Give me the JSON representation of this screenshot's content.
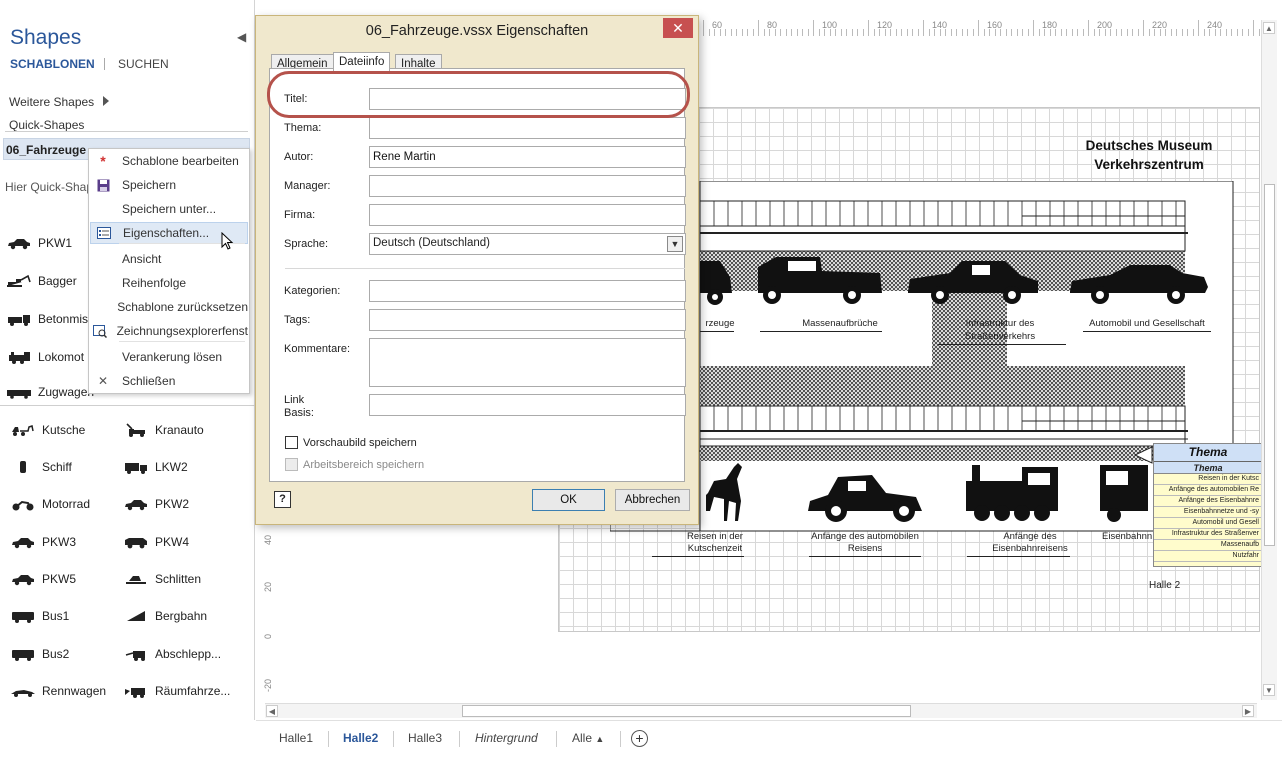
{
  "shapes_pane": {
    "title": "Shapes",
    "tab_schablonen": "SCHABLONEN",
    "tab_suchen": "SUCHEN",
    "weitere_shapes": "Weitere Shapes",
    "quick_shapes": "Quick-Shapes",
    "stencil_name": "06_Fahrzeuge",
    "quick_hint": "Hier Quick-Shap",
    "quick_items": [
      {
        "label": "PKW1",
        "icon": "car-icon"
      },
      {
        "label": "Bagger",
        "icon": "excavator-icon"
      },
      {
        "label": "Betonmis",
        "icon": "concrete-mixer-icon"
      },
      {
        "label": "Lokomot",
        "icon": "locomotive-icon"
      },
      {
        "label": "Zugwagen",
        "icon": "train-wagon-icon"
      }
    ],
    "stencil_items": [
      {
        "label": "Kutsche",
        "icon": "carriage-icon"
      },
      {
        "label": "Kranauto",
        "icon": "crane-truck-icon"
      },
      {
        "label": "Schiff",
        "icon": "ship-icon"
      },
      {
        "label": "LKW2",
        "icon": "truck-icon"
      },
      {
        "label": "Motorrad",
        "icon": "motorcycle-icon"
      },
      {
        "label": "PKW2",
        "icon": "car-icon"
      },
      {
        "label": "PKW3",
        "icon": "car-icon"
      },
      {
        "label": "PKW4",
        "icon": "suv-icon"
      },
      {
        "label": "PKW5",
        "icon": "car-icon"
      },
      {
        "label": "Schlitten",
        "icon": "sled-icon"
      },
      {
        "label": "Bus1",
        "icon": "bus-icon"
      },
      {
        "label": "Bergbahn",
        "icon": "cable-car-icon"
      },
      {
        "label": "Bus2",
        "icon": "bus-icon"
      },
      {
        "label": "Abschlepp...",
        "icon": "tow-truck-icon"
      },
      {
        "label": "Rennwagen",
        "icon": "race-car-icon"
      },
      {
        "label": "Räumfahrze...",
        "icon": "snow-plow-icon"
      }
    ]
  },
  "context_menu": {
    "items": [
      {
        "label": "Schablone bearbeiten",
        "icon": "edit-stencil-icon"
      },
      {
        "label": "Speichern",
        "icon": "save-icon"
      },
      {
        "label": "Speichern unter...",
        "icon": ""
      },
      {
        "label": "Eigenschaften...",
        "icon": "properties-icon"
      },
      {
        "label": "Ansicht",
        "icon": ""
      },
      {
        "label": "Reihenfolge",
        "icon": ""
      },
      {
        "label": "Schablone zurücksetzen",
        "icon": ""
      },
      {
        "label": "Zeichnungsexplorerfenst",
        "icon": "drawing-explorer-icon"
      },
      {
        "label": "Verankerung lösen",
        "icon": ""
      },
      {
        "label": "Schließen",
        "icon": "close-icon"
      }
    ],
    "highlighted": "Eigenschaften..."
  },
  "dialog": {
    "title": "06_Fahrzeuge.vssx Eigenschaften",
    "tabs": [
      "Allgemein",
      "Dateiinfo",
      "Inhalte"
    ],
    "active_tab": "Dateiinfo",
    "fields": {
      "titel": {
        "label": "Titel:",
        "value": ""
      },
      "thema": {
        "label": "Thema:",
        "value": ""
      },
      "autor": {
        "label": "Autor:",
        "value": "Rene Martin"
      },
      "manager": {
        "label": "Manager:",
        "value": ""
      },
      "firma": {
        "label": "Firma:",
        "value": ""
      },
      "sprache": {
        "label": "Sprache:",
        "value": "Deutsch (Deutschland)"
      },
      "kategorien": {
        "label": "Kategorien:",
        "value": ""
      },
      "tags": {
        "label": "Tags:",
        "value": ""
      },
      "kommentare": {
        "label": "Kommentare:",
        "value": ""
      },
      "link_basis": {
        "label_line1": "Link",
        "label_line2": "Basis:",
        "value": ""
      }
    },
    "vorschaubild": {
      "label": "Vorschaubild speichern",
      "checked": false
    },
    "arbeitsbereich": {
      "label": "Arbeitsbereich speichern",
      "checked": false,
      "disabled": true
    },
    "help_label": "?",
    "ok_label": "OK",
    "cancel_label": "Abbrechen"
  },
  "canvas": {
    "museum_title_line1": "Deutsches Museum",
    "museum_title_line2": "Verkehrszentrum",
    "captions_top": [
      "rzeuge",
      "Massenaufbrüche",
      "Infrastruktur des",
      "Straßenverkehrs",
      "Automobil und Gesellschaft"
    ],
    "captions_bottom": [
      "Reisen in der",
      "Kutschenzeit",
      "Anfänge des automobilen",
      "Reisens",
      "Anfänge des",
      "Eisenbahnreisens",
      "Eisenbahnn"
    ],
    "halle_label": "Halle 2",
    "legend": {
      "title": "Thema",
      "subtitle": "Thema",
      "rows": [
        "Reisen in der Kutsc",
        "Anfänge des automobilen Re",
        "Anfänge des Eisenbahnre",
        "Eisenbahnnetze und -sy",
        "Automobil und Gesell",
        "Infrastruktur des Straßenver",
        "Massenaufb",
        "Nutzfahr"
      ]
    },
    "ruler_top_labels": [
      "60",
      "80",
      "100",
      "120",
      "140",
      "160",
      "180",
      "200",
      "220",
      "240"
    ],
    "ruler_left_labels": [
      "40",
      "20",
      "0",
      "-20"
    ]
  },
  "page_tabs": {
    "tabs": [
      "Halle1",
      "Halle2",
      "Halle3",
      "Hintergrund",
      "Alle"
    ],
    "active": "Halle2"
  }
}
